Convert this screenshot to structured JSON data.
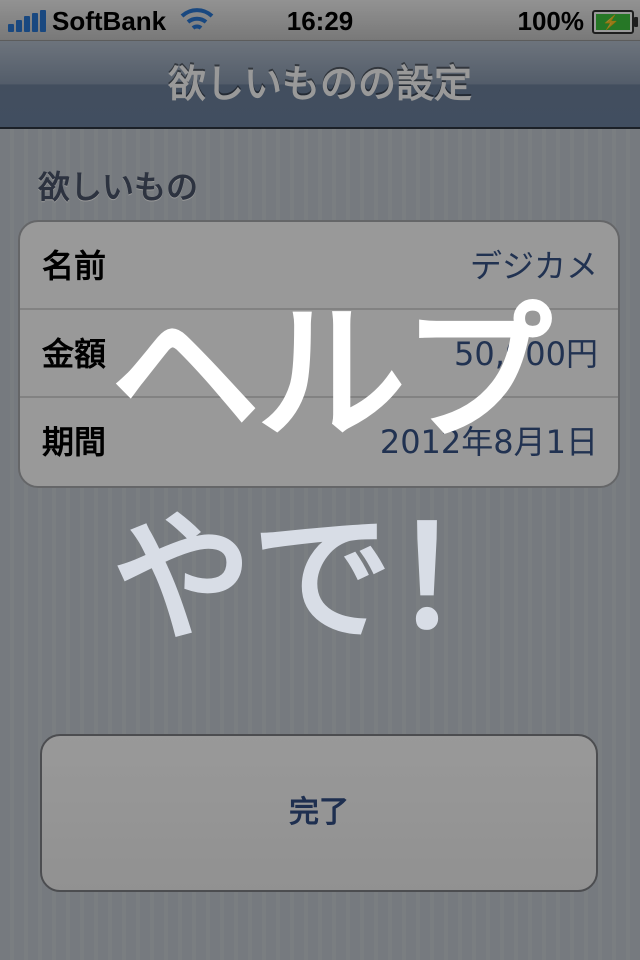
{
  "status_bar": {
    "carrier": "SoftBank",
    "time": "16:29",
    "battery_percent": "100%",
    "signal_icon": "signal-bars-icon",
    "wifi_icon": "wifi-icon",
    "battery_icon": "battery-charging-icon"
  },
  "navbar": {
    "title": "欲しいものの設定"
  },
  "section": {
    "header": "欲しいもの"
  },
  "rows": [
    {
      "label": "名前",
      "value": "デジカメ"
    },
    {
      "label": "金額",
      "value": "50,000円"
    },
    {
      "label": "期間",
      "value": "2012年8月1日"
    }
  ],
  "done_button": {
    "label": "完了"
  },
  "help_overlay": {
    "line1": "ヘルプ",
    "line2": "やで！"
  },
  "colors": {
    "navbar": "#6d83a1",
    "value_text": "#385487",
    "overlay": "rgba(0,0,0,0.40)"
  }
}
